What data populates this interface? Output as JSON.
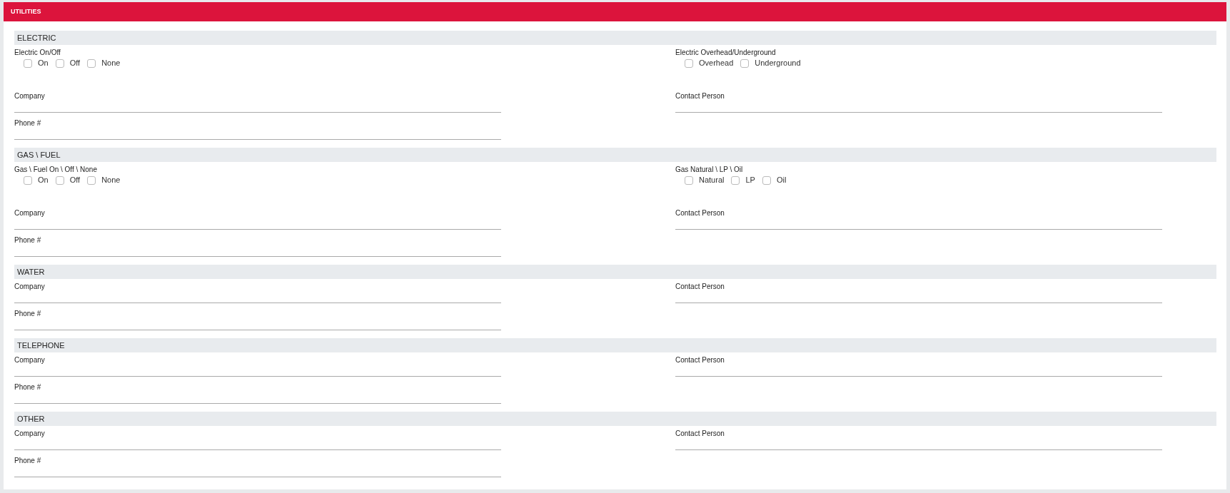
{
  "panel": {
    "title": "UTILITIES"
  },
  "sections": [
    {
      "title": "ELECTRIC",
      "check_groups": [
        {
          "label": "Electric On/Off",
          "options": [
            {
              "label": "On",
              "checked": false
            },
            {
              "label": "Off",
              "checked": false
            },
            {
              "label": "None",
              "checked": false
            }
          ]
        },
        {
          "label": "Electric Overhead/Underground",
          "options": [
            {
              "label": "Overhead",
              "checked": false
            },
            {
              "label": "Underground",
              "checked": false
            }
          ]
        }
      ],
      "fields": [
        {
          "label": "Company"
        },
        {
          "label": "Contact Person"
        },
        {
          "label": "Phone #"
        }
      ]
    },
    {
      "title": "GAS \\ FUEL",
      "check_groups": [
        {
          "label": "Gas \\ Fuel On \\ Off \\ None",
          "options": [
            {
              "label": "On",
              "checked": false
            },
            {
              "label": "Off",
              "checked": false
            },
            {
              "label": "None",
              "checked": false
            }
          ]
        },
        {
          "label": "Gas Natural \\ LP \\ Oil",
          "options": [
            {
              "label": "Natural",
              "checked": false
            },
            {
              "label": "LP",
              "checked": false
            },
            {
              "label": "Oil",
              "checked": false
            }
          ]
        }
      ],
      "fields": [
        {
          "label": "Company"
        },
        {
          "label": "Contact Person"
        },
        {
          "label": "Phone #"
        }
      ]
    },
    {
      "title": "WATER",
      "fields": [
        {
          "label": "Company"
        },
        {
          "label": "Contact Person"
        },
        {
          "label": "Phone #"
        }
      ]
    },
    {
      "title": "TELEPHONE",
      "fields": [
        {
          "label": "Company"
        },
        {
          "label": "Contact Person"
        },
        {
          "label": "Phone #"
        }
      ]
    },
    {
      "title": "OTHER",
      "fields": [
        {
          "label": "Company"
        },
        {
          "label": "Contact Person"
        },
        {
          "label": "Phone #"
        }
      ]
    }
  ]
}
